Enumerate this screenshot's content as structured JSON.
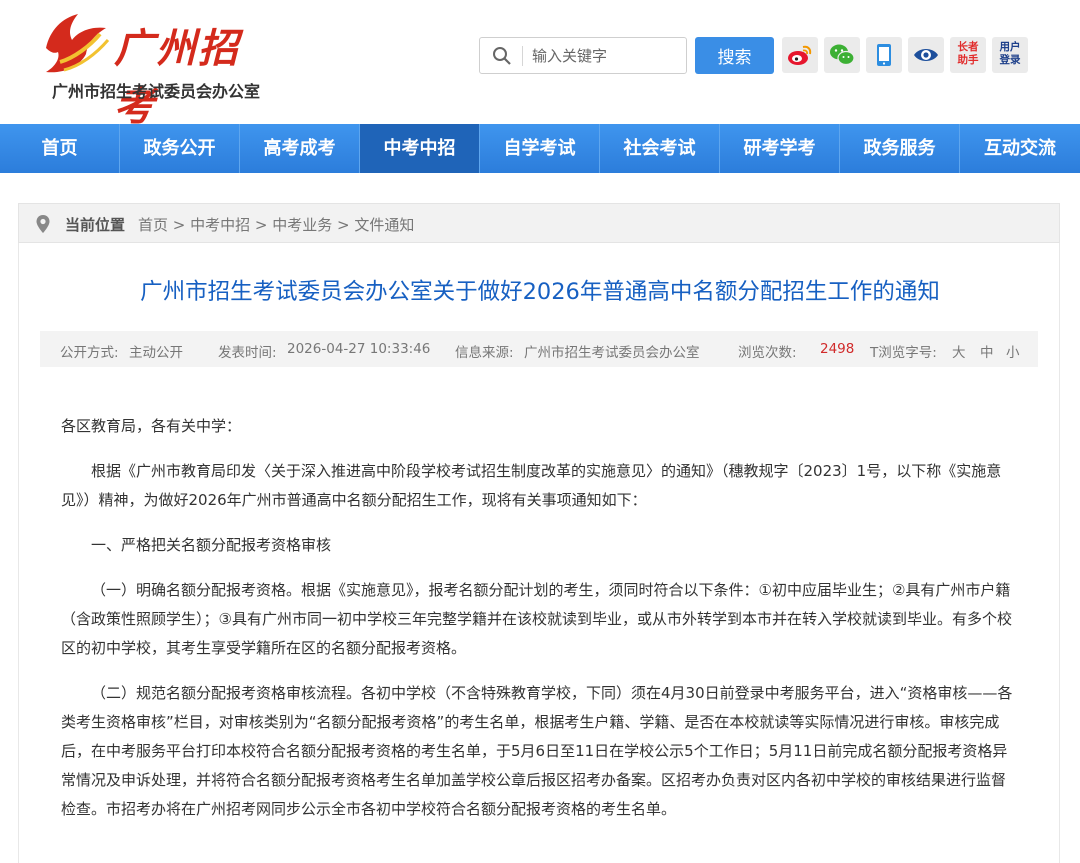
{
  "site": {
    "logo_text": "广州招考",
    "subtitle": "广州市招生考试委员会办公室"
  },
  "search": {
    "placeholder": "输入关键字",
    "button_label": "搜索"
  },
  "tools": {
    "elder_line1": "长者",
    "elder_line2": "助手",
    "login_line1": "用户",
    "login_line2": "登录"
  },
  "nav": {
    "items": [
      "首页",
      "政务公开",
      "高考成考",
      "中考中招",
      "自学考试",
      "社会考试",
      "研考学考",
      "政务服务",
      "互动交流"
    ],
    "active": "中考中招"
  },
  "breadcrumb": {
    "label": "当前位置",
    "path": [
      "首页",
      "中考中招",
      "中考业务",
      "文件通知"
    ],
    "separator": " > "
  },
  "article": {
    "title": "广州市招生考试委员会办公室关于做好2026年普通高中名额分配招生工作的通知",
    "meta": {
      "open_label": "公开方式:",
      "open_value": "主动公开",
      "date_label": "发表时间:",
      "date_value": "2026-04-27 10:33:46",
      "source_label": "信息来源:",
      "source_value": "广州市招生考试委员会办公室",
      "views_label": "浏览次数:",
      "views_value": "2498",
      "font_label": "T浏览字号:",
      "font_large": "大",
      "font_medium": "中",
      "font_small": "小"
    },
    "paragraphs": [
      "各区教育局，各有关中学：",
      "根据《广州市教育局印发〈关于深入推进高中阶段学校考试招生制度改革的实施意见〉的通知》（穗教规字〔2023〕1号，以下称《实施意见》）精神，为做好2026年广州市普通高中名额分配招生工作，现将有关事项通知如下：",
      "一、严格把关名额分配报考资格审核",
      "（一）明确名额分配报考资格。根据《实施意见》，报考名额分配计划的考生，须同时符合以下条件：①初中应届毕业生；②具有广州市户籍（含政策性照顾学生）；③具有广州市同一初中学校三年完整学籍并在该校就读到毕业，或从市外转学到本市并在转入学校就读到毕业。有多个校区的初中学校，其考生享受学籍所在区的名额分配报考资格。",
      "（二）规范名额分配报考资格审核流程。各初中学校（不含特殊教育学校，下同）须在4月30日前登录中考服务平台，进入“资格审核——各类考生资格审核”栏目，对审核类别为“名额分配报考资格”的考生名单，根据考生户籍、学籍、是否在本校就读等实际情况进行审核。审核完成后，在中考服务平台打印本校符合名额分配报考资格的考生名单，于5月6日至11日在学校公示5个工作日；5月11日前完成名额分配报考资格异常情况及申诉处理，并将符合名额分配报考资格考生名单加盖学校公章后报区招考办备案。区招考办负责对区内各初中学校的审核结果进行监督检查。市招考办将在广州招考网同步公示全市各初中学校符合名额分配报考资格的考生名单。"
    ]
  },
  "colors": {
    "nav_blue": "#2c7ddb",
    "nav_active": "#1f64b8",
    "title_blue": "#1760c2",
    "logo_red": "#d42a1c",
    "views_red": "#d12b2b"
  }
}
